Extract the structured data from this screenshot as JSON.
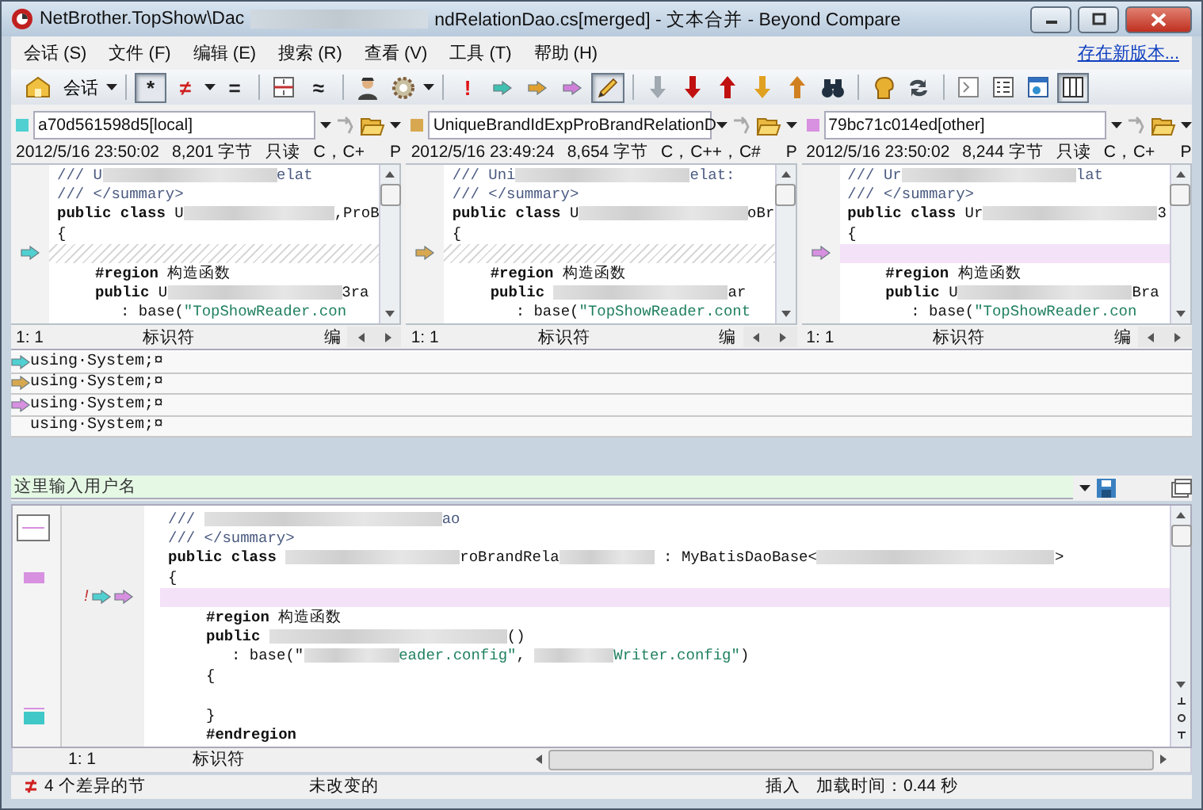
{
  "window": {
    "title_start": "NetBrother.TopShow\\Dac",
    "title_end": "ndRelationDao.cs[merged] - 文本合并 - Beyond Compare"
  },
  "menu": {
    "items": [
      "会话 (S)",
      "文件 (F)",
      "编辑 (E)",
      "搜索 (R)",
      "查看 (V)",
      "工具 (T)",
      "帮助 (H)"
    ],
    "update_link": "存在新版本..."
  },
  "toolbar": [
    {
      "kind": "home",
      "pressed": false
    },
    {
      "kind": "label",
      "text": "会话",
      "dropdown": true,
      "pressed": false
    },
    {
      "kind": "sep"
    },
    {
      "kind": "glyph",
      "text": "*",
      "color": "#202020",
      "pressed": true
    },
    {
      "kind": "glyph",
      "text": "≠",
      "color": "#d02020",
      "dropdown": true,
      "pressed": false
    },
    {
      "kind": "glyph",
      "text": "=",
      "color": "#202020",
      "pressed": false
    },
    {
      "kind": "sep"
    },
    {
      "kind": "split",
      "pressed": false
    },
    {
      "kind": "glyph",
      "text": "≈",
      "color": "#202020",
      "pressed": false
    },
    {
      "kind": "sep"
    },
    {
      "kind": "person",
      "pressed": false
    },
    {
      "kind": "gear",
      "dropdown": true,
      "pressed": false
    },
    {
      "kind": "sep"
    },
    {
      "kind": "glyph",
      "text": "!",
      "color": "#e01010",
      "pressed": false
    },
    {
      "kind": "arrow-right",
      "color": "#40c0b0",
      "pressed": false
    },
    {
      "kind": "arrow-right",
      "color": "#e0a030",
      "pressed": false
    },
    {
      "kind": "arrow-right",
      "color": "#d080d8",
      "pressed": false
    },
    {
      "kind": "pencil",
      "pressed": true
    },
    {
      "kind": "sep"
    },
    {
      "kind": "arrow-down",
      "color": "#a0a8b0",
      "pressed": false
    },
    {
      "kind": "arrow-down",
      "color": "#c01010",
      "pressed": false
    },
    {
      "kind": "arrow-up",
      "color": "#c01010",
      "pressed": false
    },
    {
      "kind": "arrow-down",
      "color": "#e0a020",
      "pressed": false
    },
    {
      "kind": "arrow-up",
      "color": "#d08020",
      "pressed": false
    },
    {
      "kind": "binoculars",
      "pressed": false
    },
    {
      "kind": "sep"
    },
    {
      "kind": "head",
      "pressed": false
    },
    {
      "kind": "swap",
      "pressed": false
    },
    {
      "kind": "sep"
    },
    {
      "kind": "panel",
      "pressed": false
    },
    {
      "kind": "list",
      "pressed": false
    },
    {
      "kind": "window",
      "pressed": false
    },
    {
      "kind": "columns",
      "pressed": true
    }
  ],
  "panes": [
    {
      "file": "a70d561598d5[local]",
      "color": "#50d0d0",
      "info": [
        "2012/5/16 23:50:02",
        "8,201 字节",
        "只读",
        "C，C+"
      ],
      "info_end": "P",
      "lines": [
        {
          "kind": "normal",
          "parts": [
            {
              "kind": "cmt",
              "text": "/// U"
            },
            {
              "kind": "blur-long"
            },
            {
              "kind": "cmt",
              "text": "elat"
            }
          ]
        },
        {
          "kind": "normal",
          "parts": [
            {
              "kind": "cmt",
              "text": "/// </summary>"
            }
          ]
        },
        {
          "kind": "normal",
          "parts": [
            {
              "kind": "kw",
              "text": "public class "
            },
            {
              "kind": "txt",
              "text": "U"
            },
            {
              "kind": "blur-long"
            },
            {
              "kind": "txt",
              "text": ",ProB"
            }
          ]
        },
        {
          "kind": "normal",
          "parts": [
            {
              "kind": "txt",
              "text": "{"
            }
          ]
        },
        {
          "kind": "hatched",
          "marker": true
        },
        {
          "kind": "normal",
          "indent": true,
          "parts": [
            {
              "kind": "kw",
              "text": "#region "
            },
            {
              "kind": "txt",
              "text": "构造函数"
            }
          ]
        },
        {
          "kind": "normal",
          "indent": true,
          "parts": [
            {
              "kind": "kw",
              "text": "public "
            },
            {
              "kind": "txt",
              "text": "U"
            },
            {
              "kind": "blur-long"
            },
            {
              "kind": "txt",
              "text": "3ra"
            }
          ]
        },
        {
          "kind": "normal",
          "indent2": true,
          "parts": [
            {
              "kind": "txt",
              "text": ": base("
            },
            {
              "kind": "str",
              "text": "\"TopShowReader.con"
            }
          ]
        }
      ],
      "status": [
        "1: 1",
        "标识符",
        "编"
      ]
    },
    {
      "file": "UniqueBrandIdExpProBrandRelationD",
      "color": "#d8a850",
      "info": [
        "2012/5/16 23:49:24",
        "8,654 字节",
        "C，C++，C#"
      ],
      "info_end": "P",
      "lines": [
        {
          "kind": "normal",
          "parts": [
            {
              "kind": "cmt",
              "text": "/// Uni"
            },
            {
              "kind": "blur-long"
            },
            {
              "kind": "cmt",
              "text": "elat:"
            }
          ]
        },
        {
          "kind": "normal",
          "parts": [
            {
              "kind": "cmt",
              "text": "/// </summary>"
            }
          ]
        },
        {
          "kind": "normal",
          "parts": [
            {
              "kind": "kw",
              "text": "public class "
            },
            {
              "kind": "txt",
              "text": "U"
            },
            {
              "kind": "blur-long"
            },
            {
              "kind": "txt",
              "text": "oBr"
            }
          ]
        },
        {
          "kind": "normal",
          "parts": [
            {
              "kind": "txt",
              "text": "{"
            }
          ]
        },
        {
          "kind": "hatched",
          "marker": true
        },
        {
          "kind": "normal",
          "indent": true,
          "parts": [
            {
              "kind": "kw",
              "text": "#region "
            },
            {
              "kind": "txt",
              "text": "构造函数"
            }
          ]
        },
        {
          "kind": "normal",
          "indent": true,
          "parts": [
            {
              "kind": "kw",
              "text": "public "
            },
            {
              "kind": "blur-long"
            },
            {
              "kind": "txt",
              "text": "ar"
            }
          ]
        },
        {
          "kind": "normal",
          "indent2": true,
          "parts": [
            {
              "kind": "txt",
              "text": ": base("
            },
            {
              "kind": "str",
              "text": "\"TopShowReader.cont"
            }
          ]
        }
      ],
      "status": [
        "1: 1",
        "标识符",
        "编"
      ]
    },
    {
      "file": "79bc71c014ed[other]",
      "color": "#d890e0",
      "info": [
        "2012/5/16 23:50:02",
        "8,244 字节",
        "只读",
        "C，C+"
      ],
      "info_end": "P",
      "lines": [
        {
          "kind": "normal",
          "parts": [
            {
              "kind": "cmt",
              "text": "/// Ur"
            },
            {
              "kind": "blur-long"
            },
            {
              "kind": "cmt",
              "text": "lat"
            }
          ]
        },
        {
          "kind": "normal",
          "parts": [
            {
              "kind": "cmt",
              "text": "/// </summary>"
            }
          ]
        },
        {
          "kind": "normal",
          "parts": [
            {
              "kind": "kw",
              "text": "public class "
            },
            {
              "kind": "txt",
              "text": "Ur"
            },
            {
              "kind": "blur-long"
            },
            {
              "kind": "txt",
              "text": "3"
            }
          ]
        },
        {
          "kind": "normal",
          "parts": [
            {
              "kind": "txt",
              "text": "{"
            }
          ]
        },
        {
          "kind": "pink",
          "marker": true
        },
        {
          "kind": "normal",
          "indent": true,
          "parts": [
            {
              "kind": "kw",
              "text": "#region "
            },
            {
              "kind": "txt",
              "text": "构造函数"
            }
          ]
        },
        {
          "kind": "normal",
          "indent": true,
          "parts": [
            {
              "kind": "kw",
              "text": "public "
            },
            {
              "kind": "txt",
              "text": "U"
            },
            {
              "kind": "blur-long"
            },
            {
              "kind": "txt",
              "text": "Bra"
            }
          ]
        },
        {
          "kind": "normal",
          "indent2": true,
          "parts": [
            {
              "kind": "txt",
              "text": ": base("
            },
            {
              "kind": "str",
              "text": "\"TopShowReader.con"
            }
          ]
        }
      ],
      "status": [
        "1: 1",
        "标识符",
        "编"
      ]
    }
  ],
  "line_preview": [
    {
      "text": "using·System;¤",
      "color": "#50d0d0"
    },
    {
      "text": "using·System;¤",
      "color": "#d8a850"
    },
    {
      "text": "using·System;¤",
      "color": "#d890e0"
    },
    {
      "text": "using·System;¤"
    }
  ],
  "output": {
    "placeholder": "这里输入用户名",
    "lines": [
      {
        "kind": "normal",
        "parts": [
          {
            "kind": "cmt",
            "text": "/// "
          },
          {
            "kind": "blur-xlong"
          },
          {
            "kind": "cmt",
            "text": "ao"
          }
        ]
      },
      {
        "kind": "normal",
        "parts": [
          {
            "kind": "cmt",
            "text": "/// </summary>"
          }
        ]
      },
      {
        "kind": "normal",
        "parts": [
          {
            "kind": "kw",
            "text": "public class "
          },
          {
            "kind": "blur-long"
          },
          {
            "kind": "txt",
            "text": "roBrandRela"
          },
          {
            "kind": "blur-medium"
          },
          {
            "kind": "txt",
            "text": " : MyBatisDaoBase<"
          },
          {
            "kind": "blur-xlong"
          },
          {
            "kind": "txt",
            "text": ">"
          }
        ]
      },
      {
        "kind": "normal",
        "parts": [
          {
            "kind": "txt",
            "text": "{"
          }
        ]
      },
      {
        "kind": "pink",
        "flag": "!",
        "markers": [
          {
            "color": "#50d0d0"
          },
          {
            "color": "#d890e0"
          }
        ]
      },
      {
        "kind": "normal",
        "indent": true,
        "parts": [
          {
            "kind": "kw",
            "text": "#region "
          },
          {
            "kind": "txt",
            "text": "构造函数"
          }
        ]
      },
      {
        "kind": "normal",
        "indent": true,
        "parts": [
          {
            "kind": "kw",
            "text": "public "
          },
          {
            "kind": "blur-xlong"
          },
          {
            "kind": "txt",
            "text": "()"
          }
        ]
      },
      {
        "kind": "normal",
        "indent2": true,
        "parts": [
          {
            "kind": "txt",
            "text": ": base(\""
          },
          {
            "kind": "blur-medium"
          },
          {
            "kind": "str",
            "text": "eader.config\""
          },
          {
            "kind": "txt",
            "text": ", "
          },
          {
            "kind": "blur-short"
          },
          {
            "kind": "str",
            "text": "Writer.config\""
          },
          {
            "kind": "txt",
            "text": ")"
          }
        ]
      },
      {
        "kind": "normal",
        "indent": true,
        "parts": [
          {
            "kind": "txt",
            "text": "{"
          }
        ]
      },
      {
        "kind": "normal"
      },
      {
        "kind": "normal",
        "indent": true,
        "parts": [
          {
            "kind": "txt",
            "text": "}"
          }
        ]
      },
      {
        "kind": "normal",
        "indent": true,
        "parts": [
          {
            "kind": "kw",
            "text": "#endregion"
          }
        ]
      }
    ],
    "status": [
      "1: 1",
      "标识符"
    ]
  },
  "status_bar": {
    "differences": "4 个差异的节",
    "state": "未改变的",
    "mode": "插入",
    "load_time": "加载时间：0.44 秒"
  }
}
